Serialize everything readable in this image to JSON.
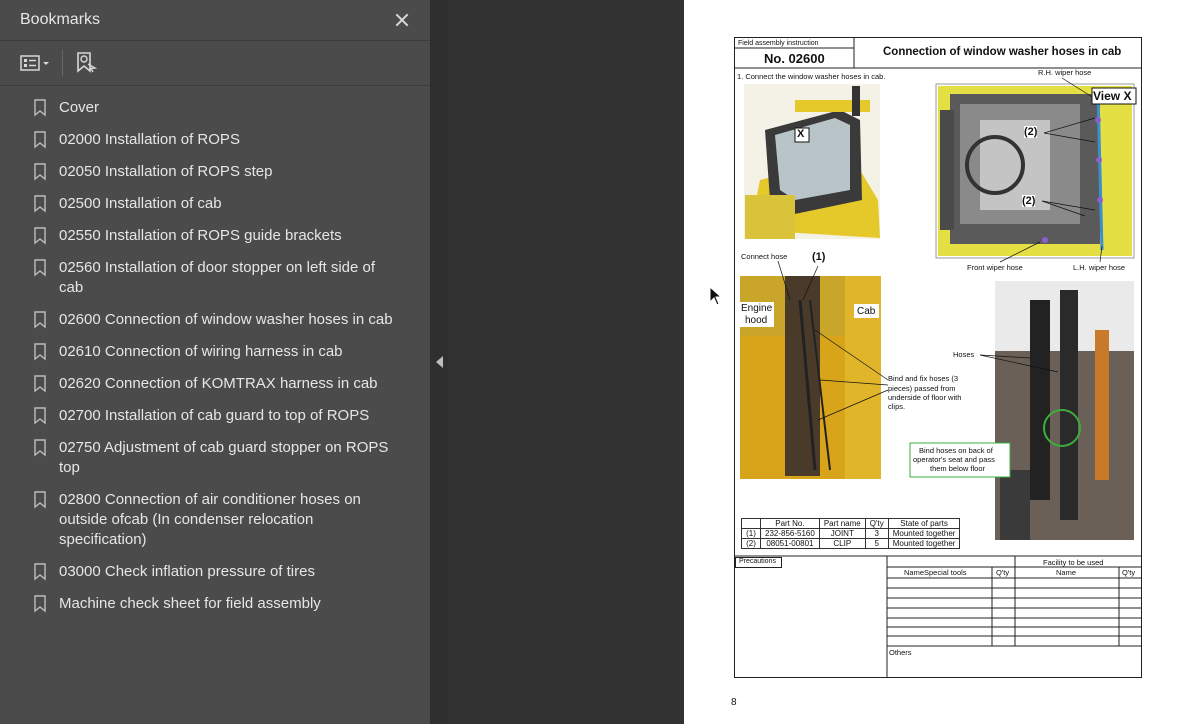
{
  "bookmarks_panel": {
    "title": "Bookmarks",
    "items": [
      {
        "label": "Cover"
      },
      {
        "label": "02000 Installation of ROPS"
      },
      {
        "label": "02050 Installation of ROPS step"
      },
      {
        "label": "02500 Installation of cab"
      },
      {
        "label": "02550 Installation of ROPS guide brackets"
      },
      {
        "label": "02560 Installation of door stopper on left side of cab"
      },
      {
        "label": "02600 Connection of window washer hoses in cab"
      },
      {
        "label": "02610 Connection of wiring harness in cab"
      },
      {
        "label": "02620 Connection of KOMTRAX harness in cab"
      },
      {
        "label": "02700 Installation of cab guard to top of ROPS"
      },
      {
        "label": "02750 Adjustment of cab guard stopper on ROPS top"
      },
      {
        "label": "02800 Connection of air conditioner hoses on outside ofcab (In condenser relocation specification)"
      },
      {
        "label": "03000 Check inflation pressure of tires"
      },
      {
        "label": "Machine check sheet for field assembly"
      }
    ]
  },
  "document": {
    "header_label": "Field assembly instruction",
    "doc_number": "No. 02600",
    "title": "Connection of window washer hoses in cab",
    "step1": "1. Connect the window washer hoses in cab.",
    "callout_x": "X",
    "view_x": "View X",
    "rh_wiper_hose": "R.H. wiper hose",
    "front_wiper_hose": "Front wiper hose",
    "lh_wiper_hose": "L.H. wiper hose",
    "marker_2a": "(2)",
    "marker_2b": "(2)",
    "connect_hose": "Connect hose",
    "marker_1": "(1)",
    "engine_hood_1": "Engine",
    "engine_hood_2": "hood",
    "cab": "Cab",
    "bind_fix_1": "Bind and fix hoses (3",
    "bind_fix_2": "pieces) passed from",
    "bind_fix_3": "underside of floor with",
    "bind_fix_4": "clips.",
    "hoses": "Hoses",
    "bind_back_1": "Bind hoses on back of",
    "bind_back_2": "operator's seat and pass",
    "bind_back_3": "them below floor",
    "parts_headers": [
      "Part No.",
      "Part name",
      "Q'ty",
      "State of parts"
    ],
    "parts_rows": [
      [
        "(1)",
        "232-856-5160",
        "JOINT",
        "3",
        "Mounted together"
      ],
      [
        "(2)",
        "08051-00801",
        "CLIP",
        "5",
        "Mounted together"
      ]
    ],
    "precautions": "Precautions",
    "facility_header": "Facility to be used",
    "special_tools": "NameSpecial tools",
    "qty": "Q'ty",
    "name": "Name",
    "qty2": "Q'ty",
    "others": "Others",
    "page_number": "8"
  }
}
